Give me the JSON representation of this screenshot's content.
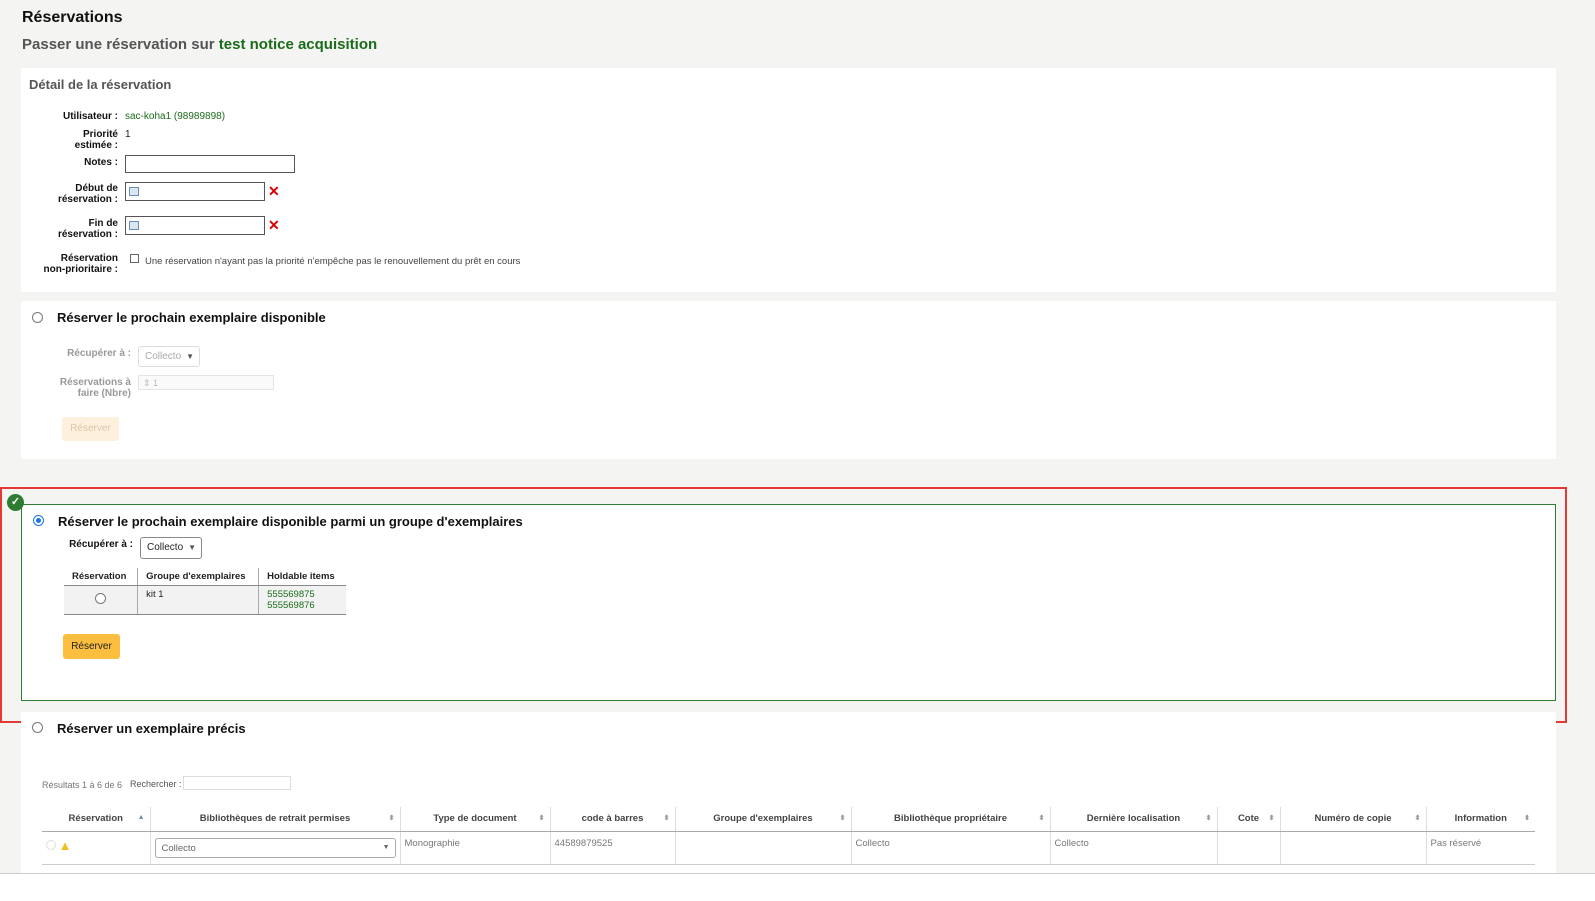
{
  "header": {
    "title": "Réservations",
    "subtitle_prefix": "Passer une réservation sur",
    "record_title": "test notice acquisition"
  },
  "detail": {
    "title": "Détail de la réservation",
    "user_label": "Utilisateur :",
    "user_value": "sac-koha1 (98989898)",
    "priority_label_1": "Priorité",
    "priority_label_2": "estimée :",
    "priority_value": "1",
    "notes_label": "Notes :",
    "start_label_1": "Début de",
    "start_label_2": "réservation :",
    "end_label_1": "Fin de",
    "end_label_2": "réservation :",
    "nonpriority_label_1": "Réservation",
    "nonpriority_label_2": "non-prioritaire :",
    "nonpriority_text": "Une réservation n'ayant pas la priorité n'empêche pas le renouvellement du prêt en cours"
  },
  "next_available": {
    "title": "Réserver le prochain exemplaire disponible",
    "pickup_label": "Récupérer à :",
    "pickup_value": "Collecto",
    "count_label_1": "Réservations à",
    "count_label_2": "faire (Nbre)",
    "count_value": "1",
    "button": "Réserver"
  },
  "group_section": {
    "title": "Réserver le prochain exemplaire disponible parmi un groupe d'exemplaires",
    "pickup_label": "Récupérer à :",
    "pickup_value": "Collecto",
    "columns": [
      "Réservation",
      "Groupe d'exemplaires",
      "Holdable items"
    ],
    "row": {
      "group": "kit 1",
      "items": [
        "555569875",
        "555569876"
      ]
    },
    "button": "Réserver"
  },
  "specific": {
    "title": "Réserver un exemplaire précis",
    "results_info": "Résultats 1 à 6 de 6",
    "search_label": "Rechercher :",
    "columns": [
      "Réservation",
      "Bibliothèques de retrait permises",
      "Type de document",
      "code à barres",
      "Groupe d'exemplaires",
      "Bibliothèque propriétaire",
      "Dernière localisation",
      "Cote",
      "Numéro de copie",
      "Information"
    ],
    "row": {
      "pickup": "Collecto",
      "type": "Monographie",
      "barcode": "44589879525",
      "group": "",
      "owner": "Collecto",
      "location": "Collecto",
      "callnumber": "",
      "copy": "",
      "info": "Pas réservé"
    }
  },
  "colors": {
    "accent_green": "#1a6b1a",
    "highlight_red": "#e53935",
    "button_yellow": "#fbbe3e",
    "check_green": "#2e7d32"
  }
}
